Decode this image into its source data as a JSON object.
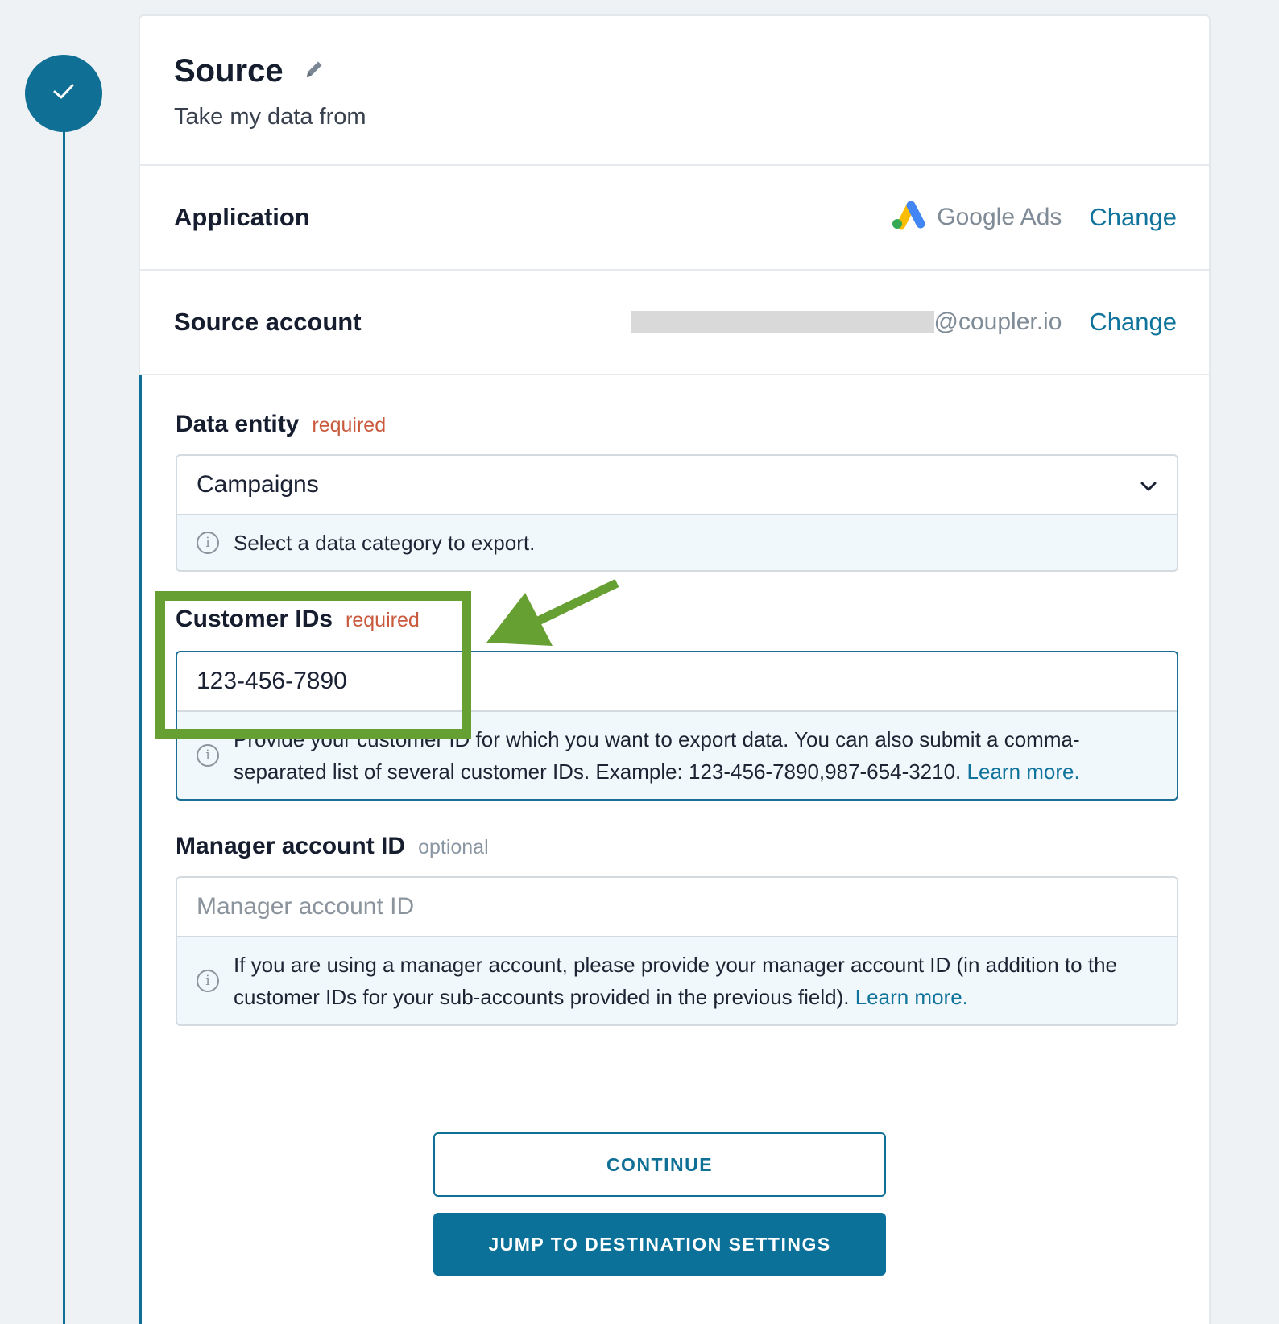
{
  "step": {
    "status_icon": "check-icon",
    "accent": "#0f6f95"
  },
  "source": {
    "title": "Source",
    "edit_icon": "pencil-icon",
    "subtitle": "Take my data from"
  },
  "application": {
    "label": "Application",
    "value": "Google Ads",
    "app_icon": "google-ads-icon",
    "change_label": "Change"
  },
  "source_account": {
    "label": "Source account",
    "value_suffix": "@coupler.io",
    "change_label": "Change"
  },
  "data_entity": {
    "label": "Data entity",
    "badge": "required",
    "value": "Campaigns",
    "hint": "Select a data category to export."
  },
  "customer_ids": {
    "label": "Customer IDs",
    "badge": "required",
    "value": "123-456-7890",
    "hint": "Provide your customer ID for which you want to export data. You can also submit a comma-separated list of several customer IDs. Example: 123-456-7890,987-654-3210.",
    "learn_more": "Learn more."
  },
  "manager_account": {
    "label": "Manager account ID",
    "badge": "optional",
    "placeholder": "Manager account ID",
    "hint": "If you are using a manager account, please provide your manager account ID (in addition to the customer IDs for your sub-accounts provided in the previous field).",
    "learn_more": "Learn more."
  },
  "buttons": {
    "continue": "CONTINUE",
    "jump": "JUMP TO DESTINATION SETTINGS"
  },
  "annotation": {
    "color": "#66a033"
  }
}
